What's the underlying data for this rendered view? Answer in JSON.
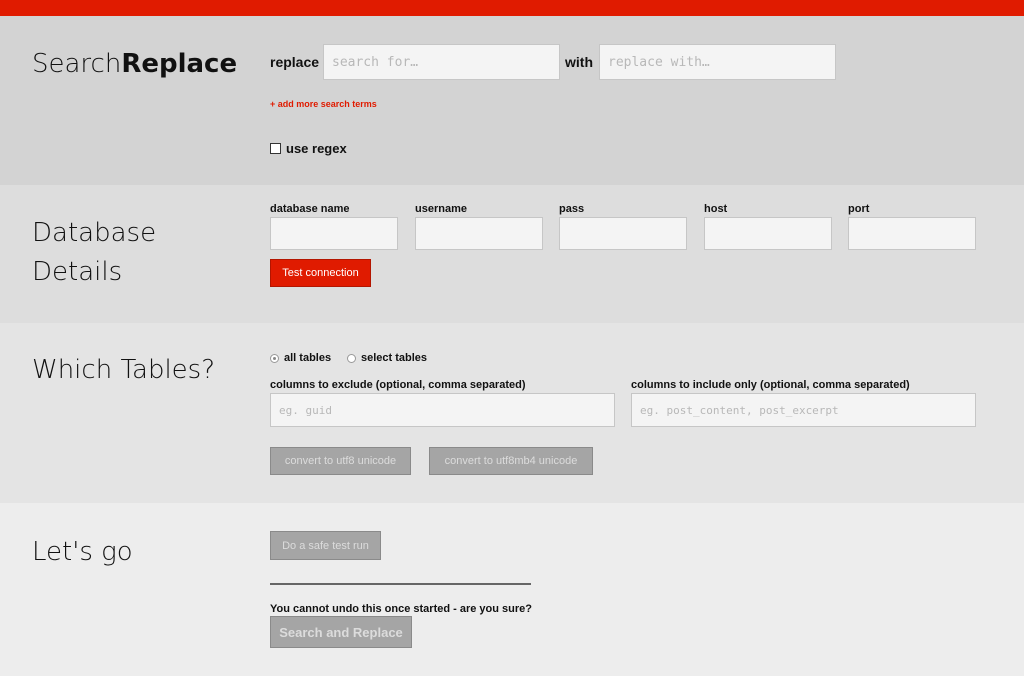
{
  "app": {
    "title_plain": "Search",
    "title_bold": "Replace"
  },
  "search": {
    "replace_label": "replace",
    "search_placeholder": "search for…",
    "with_label": "with",
    "replace_placeholder": "replace with…",
    "add_terms": "+ add more search terms",
    "regex_label": "use regex"
  },
  "database": {
    "heading_line1": "Database",
    "heading_line2": "Details",
    "fields": [
      {
        "label": "database name"
      },
      {
        "label": "username"
      },
      {
        "label": "pass"
      },
      {
        "label": "host"
      },
      {
        "label": "port"
      }
    ],
    "test_button": "Test connection"
  },
  "tables": {
    "heading": "Which Tables?",
    "radio_all": "all tables",
    "radio_select": "select tables",
    "exclude_label": "columns to exclude (optional, comma separated)",
    "exclude_placeholder": "eg. guid",
    "include_label": "columns to include only (optional, comma separated)",
    "include_placeholder": "eg. post_content, post_excerpt",
    "utf8_button": "convert to utf8 unicode",
    "utf8mb4_button": "convert to utf8mb4 unicode"
  },
  "go": {
    "heading": "Let's go",
    "test_run_button": "Do a safe test run",
    "warning": "You cannot undo this once started - are you sure?",
    "run_button": "Search and Replace"
  },
  "colors": {
    "accent": "#e01b00",
    "disabled": "#a5a5a5"
  }
}
